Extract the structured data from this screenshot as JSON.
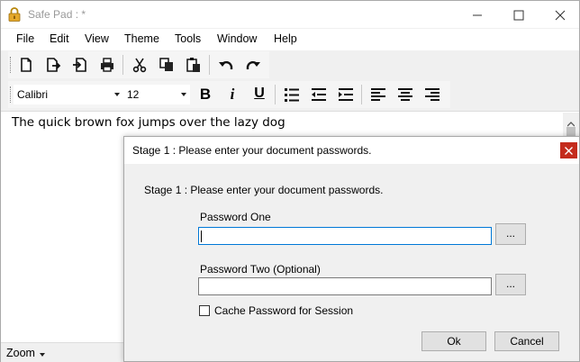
{
  "window": {
    "title": "Safe Pad : *",
    "app_icon": "lock-icon"
  },
  "menu": [
    "File",
    "Edit",
    "View",
    "Theme",
    "Tools",
    "Window",
    "Help"
  ],
  "toolbar": {
    "icons": [
      "new-document-icon",
      "open-document-icon",
      "import-document-icon",
      "print-icon",
      "cut-icon",
      "copy-icon",
      "paste-icon",
      "undo-icon",
      "redo-icon"
    ]
  },
  "format_bar": {
    "font": "Calibri",
    "size": "12",
    "bold_label": "B",
    "italic_label": "i",
    "underline_label": "U",
    "icons": [
      "bullet-list-icon",
      "outdent-icon",
      "indent-icon",
      "align-left-icon",
      "align-center-icon",
      "align-right-icon"
    ]
  },
  "editor": {
    "text": "The quick brown fox jumps over the lazy dog"
  },
  "status": {
    "zoom_label": "Zoom"
  },
  "dialog": {
    "title": "Stage 1 : Please enter your document passwords.",
    "message": "Stage 1 : Please enter your document passwords.",
    "password_one_label": "Password One",
    "password_one_value": "",
    "password_two_label": "Password Two (Optional)",
    "password_two_value": "",
    "browse_label": "...",
    "cache_label": "Cache Password for Session",
    "cache_checked": false,
    "ok_label": "Ok",
    "cancel_label": "Cancel"
  },
  "colors": {
    "close_button": "#c42b1c",
    "focus_border": "#0078d7",
    "accent_blue": "#1e5fb4"
  }
}
